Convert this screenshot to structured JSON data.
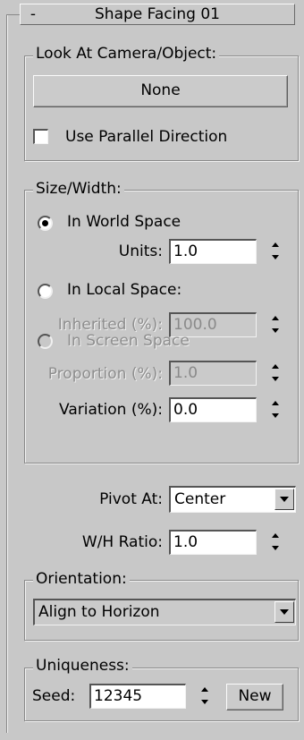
{
  "rollout": {
    "toggle_symbol": "-",
    "title": "Shape Facing 01"
  },
  "look_at": {
    "legend": "Look At Camera/Object:",
    "pick_button": "None",
    "parallel_label": "Use Parallel Direction",
    "parallel_checked": false
  },
  "size_width": {
    "legend": "Size/Width:",
    "world_space_label": "In World Space",
    "units_label": "Units:",
    "units_value": "1.0",
    "local_space_label": "In Local Space:",
    "inherited_label": "Inherited (%):",
    "inherited_value": "100.0",
    "screen_space_label": "In Screen Space",
    "proportion_label": "Proportion (%):",
    "proportion_value": "1.0",
    "variation_label": "Variation (%):",
    "variation_value": "0.0",
    "selected_mode": "In World Space"
  },
  "pivot": {
    "label": "Pivot At:",
    "value": "Center"
  },
  "wh_ratio": {
    "label": "W/H Ratio:",
    "value": "1.0"
  },
  "orientation": {
    "legend": "Orientation:",
    "value": "Align to Horizon"
  },
  "uniqueness": {
    "legend": "Uniqueness:",
    "seed_label": "Seed:",
    "seed_value": "12345",
    "new_button": "New"
  },
  "colors": {
    "panel_bg": "#c8c8c8",
    "disabled_text": "#8e8e8e",
    "field_bg": "#ffffff"
  }
}
